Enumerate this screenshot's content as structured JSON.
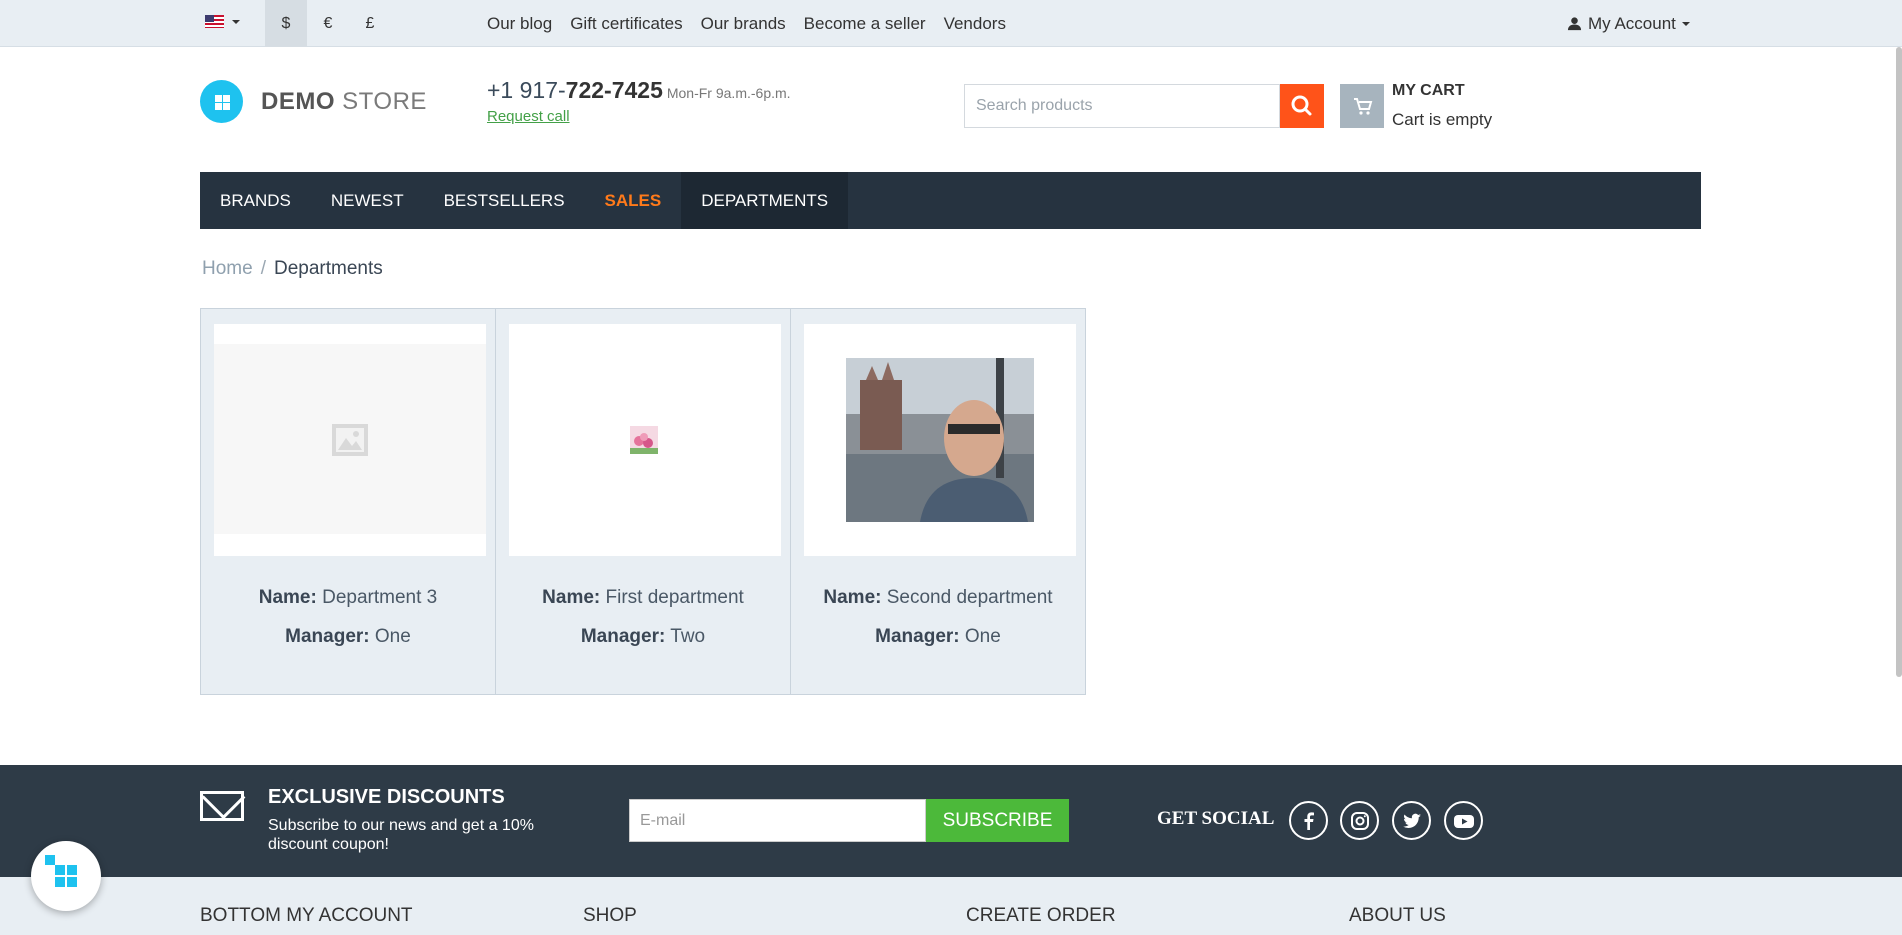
{
  "topbar": {
    "currencies": [
      "$",
      "€",
      "£"
    ],
    "links": [
      "Our blog",
      "Gift certificates",
      "Our brands",
      "Become a seller",
      "Vendors"
    ],
    "account": "My Account"
  },
  "header": {
    "logo_bold": "DEMO",
    "logo_light": "STORE",
    "phone_prefix": "+1 917-",
    "phone_main": "722-7425",
    "hours": "Mon-Fr 9a.m.-6p.m.",
    "request_call": "Request call",
    "search_placeholder": "Search products",
    "cart_title": "MY CART",
    "cart_status": "Cart is empty"
  },
  "nav": [
    "BRANDS",
    "NEWEST",
    "BESTSELLERS",
    "SALES",
    "DEPARTMENTS"
  ],
  "breadcrumb": {
    "home": "Home",
    "sep": "/",
    "current": "Departments"
  },
  "departments": [
    {
      "name_label": "Name:",
      "name": "Department 3",
      "manager_label": "Manager:",
      "manager": "One"
    },
    {
      "name_label": "Name:",
      "name": "First department",
      "manager_label": "Manager:",
      "manager": "Two"
    },
    {
      "name_label": "Name:",
      "name": "Second department",
      "manager_label": "Manager:",
      "manager": "One"
    }
  ],
  "footer": {
    "title": "EXCLUSIVE DISCOUNTS",
    "text": "Subscribe to our news and get a 10% discount coupon!",
    "email_placeholder": "E-mail",
    "subscribe": "SUBSCRIBE",
    "get_social": "GET SOCIAL",
    "columns": [
      "BOTTOM MY ACCOUNT",
      "SHOP",
      "CREATE ORDER",
      "ABOUT US"
    ]
  },
  "colors": {
    "accent": "#ff5319",
    "nav_bg": "#263340",
    "green": "#4cb93a",
    "logo": "#1ec2ef"
  }
}
